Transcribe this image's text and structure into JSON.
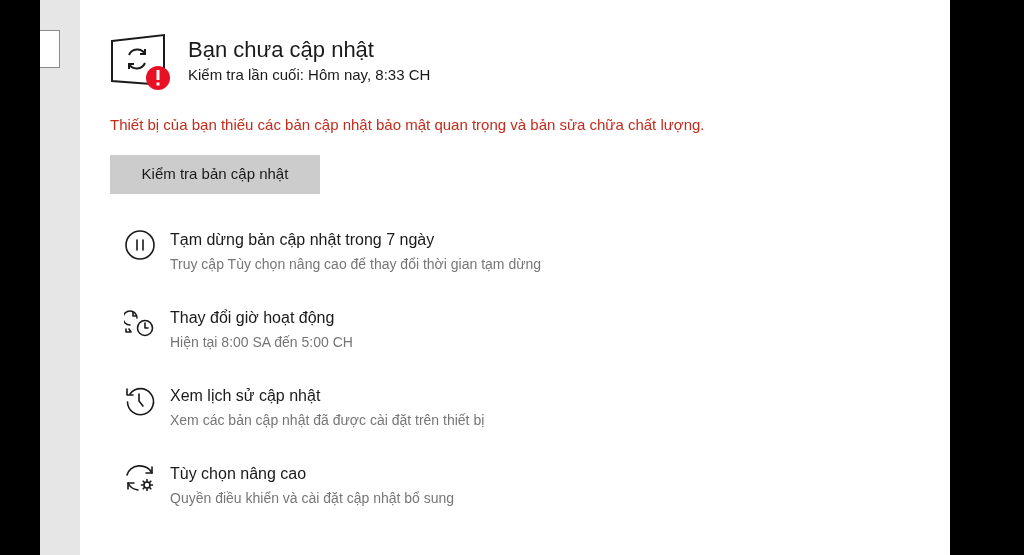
{
  "status": {
    "title": "Bạn chưa cập nhật",
    "last_checked": "Kiểm tra lần cuối: Hôm nay, 8:33 CH",
    "error": true
  },
  "warning": "Thiết bị của bạn thiếu các bản cập nhật bảo mật quan trọng và bản sửa chữa chất lượng.",
  "check_button": "Kiểm tra bản cập nhật",
  "options": [
    {
      "kind": "pause",
      "title": "Tạm dừng bản cập nhật trong 7 ngày",
      "description": "Truy cập Tùy chọn nâng cao để thay đổi thời gian tạm dừng"
    },
    {
      "kind": "active_hours",
      "title": "Thay đổi giờ hoạt động",
      "description": "Hiện tại 8:00 SA đến 5:00 CH"
    },
    {
      "kind": "history",
      "title": "Xem lịch sử cập nhật",
      "description": "Xem các bản cập nhật đã được cài đặt trên thiết bị"
    },
    {
      "kind": "advanced",
      "title": "Tùy chọn nâng cao",
      "description": "Quyền điều khiển và cài đặt cập nhật bổ sung"
    }
  ]
}
